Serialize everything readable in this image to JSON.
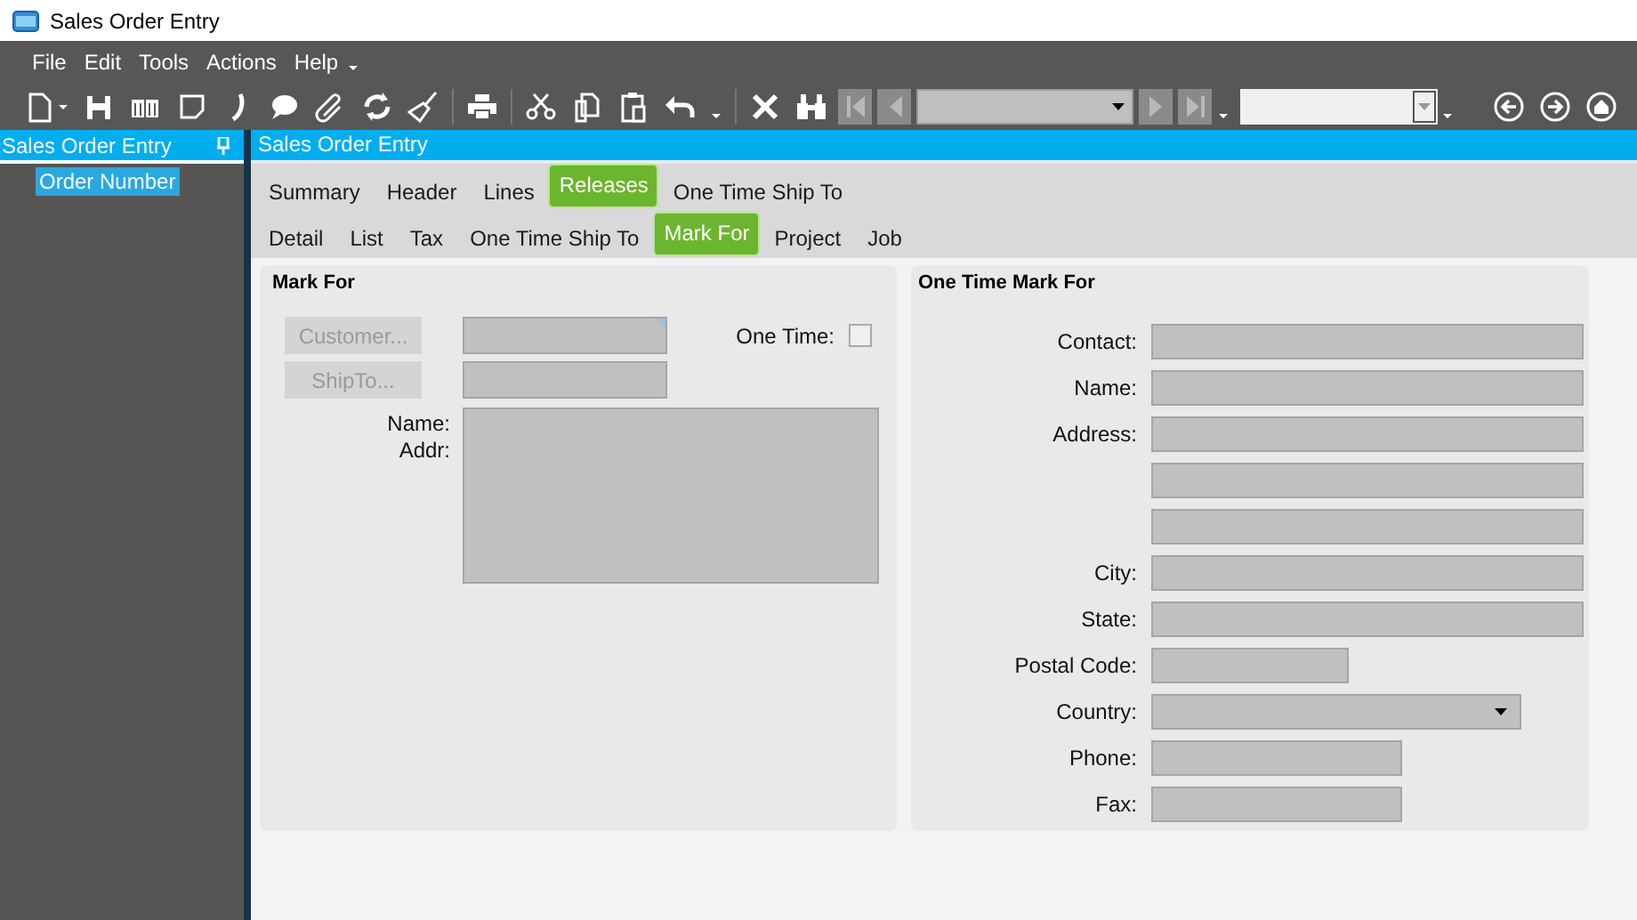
{
  "window": {
    "title": "Sales Order Entry"
  },
  "menu": [
    "File",
    "Edit",
    "Tools",
    "Actions",
    "Help"
  ],
  "side_panel": {
    "title": "Sales Order Entry",
    "items": [
      {
        "label": "Order Number",
        "selected": true
      }
    ]
  },
  "content": {
    "title": "Sales Order Entry"
  },
  "tabs": [
    {
      "label": "Summary",
      "selected": false
    },
    {
      "label": "Header",
      "selected": false
    },
    {
      "label": "Lines",
      "selected": false
    },
    {
      "label": "Releases",
      "selected": true
    },
    {
      "label": "One Time Ship To",
      "selected": false
    }
  ],
  "sub_tabs": [
    {
      "label": "Detail",
      "selected": false
    },
    {
      "label": "List",
      "selected": false
    },
    {
      "label": "Tax",
      "selected": false
    },
    {
      "label": "One Time Ship To",
      "selected": false
    },
    {
      "label": "Mark For",
      "selected": true
    },
    {
      "label": "Project",
      "selected": false
    },
    {
      "label": "Job",
      "selected": false
    }
  ],
  "mark_for": {
    "title": "Mark For",
    "buttons": [
      {
        "label": "Customer...",
        "disabled": true
      },
      {
        "label": "ShipTo...",
        "disabled": true
      }
    ],
    "one_time": {
      "label": "One Time:",
      "checked": false
    },
    "labels": [
      "Name:",
      "Addr:"
    ]
  },
  "one_time_mark_for": {
    "title": "One Time Mark For",
    "fields": [
      {
        "label": "Contact:",
        "kind": "wide"
      },
      {
        "label": "Name:",
        "kind": "wide"
      },
      {
        "label": "Address:",
        "kind": "wide"
      },
      {
        "kind": "wide"
      },
      {
        "kind": "wide"
      },
      {
        "label": "City:",
        "kind": "wide"
      },
      {
        "label": "State:",
        "kind": "wide"
      },
      {
        "label": "Postal Code:",
        "kind": "short"
      },
      {
        "label": "Country:",
        "kind": "dropdown"
      },
      {
        "label": "Phone:",
        "kind": "medium"
      },
      {
        "label": "Fax:",
        "kind": "medium"
      }
    ]
  }
}
